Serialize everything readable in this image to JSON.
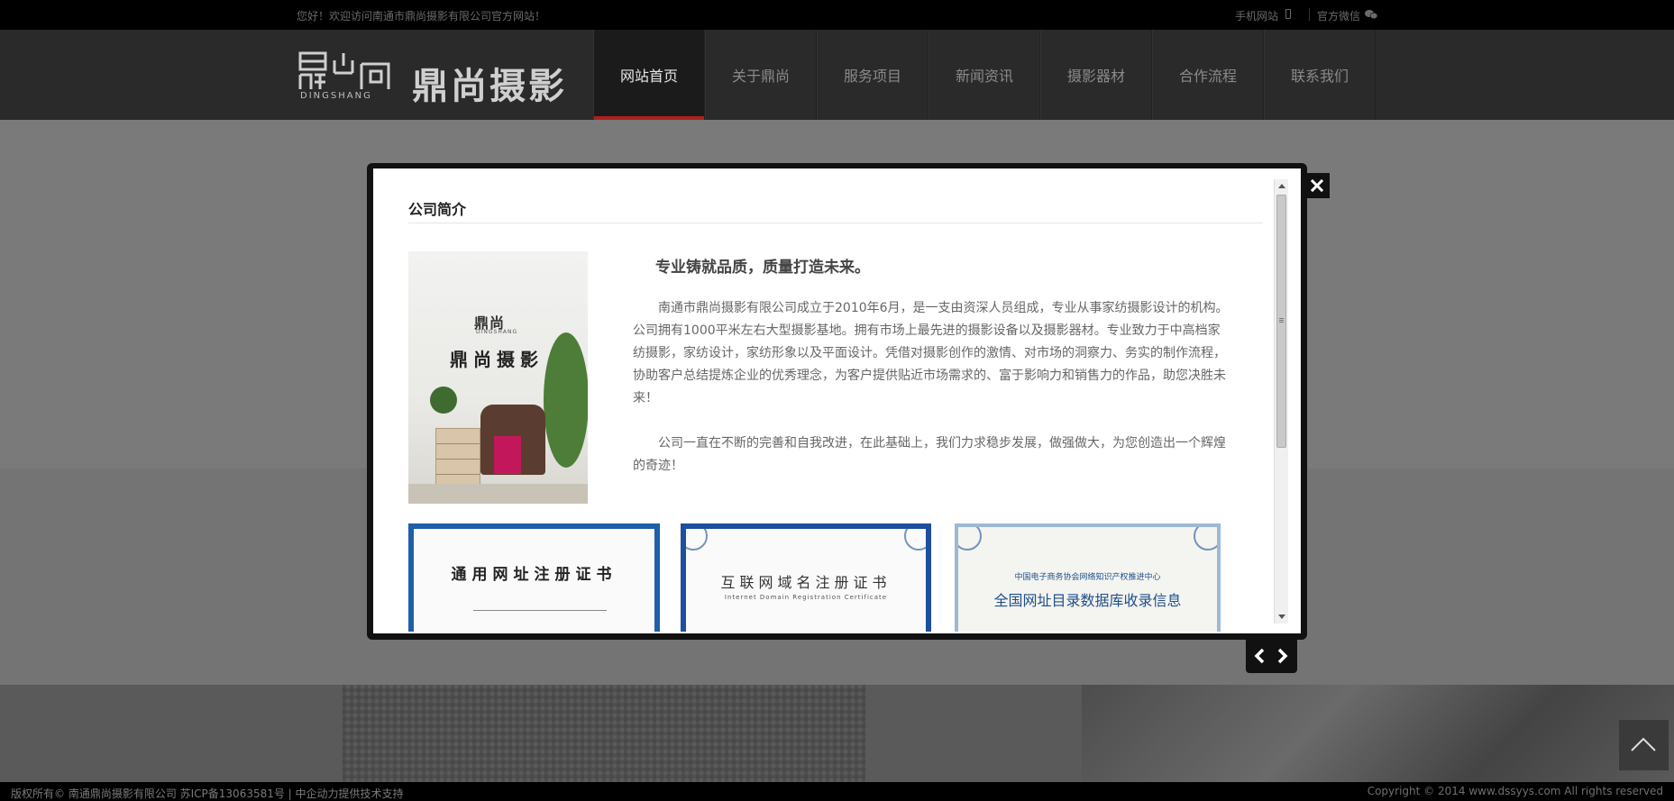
{
  "topbar": {
    "welcome": "您好！欢迎访问南通市鼎尚摄影有限公司官方网站！",
    "mobile_label": "手机网站",
    "wechat_label": "官方微信"
  },
  "logo": {
    "mark": "鼎尚",
    "en": "DINGSHANG",
    "cn": "鼎尚摄影"
  },
  "nav": {
    "items": [
      {
        "label": "网站首页"
      },
      {
        "label": "关于鼎尚"
      },
      {
        "label": "服务项目"
      },
      {
        "label": "新闻资讯"
      },
      {
        "label": "摄影器材"
      },
      {
        "label": "合作流程"
      },
      {
        "label": "联系我们"
      }
    ],
    "active_index": 0
  },
  "modal": {
    "title": "公司简介",
    "slogan": "专业铸就品质，质量打造未来。",
    "paragraph1": "南通市鼎尚摄影有限公司成立于2010年6月，是一支由资深人员组成，专业从事家纺摄影设计的机构。公司拥有1000平米左右大型摄影基地。拥有市场上最先进的摄影设备以及摄影器材。专业致力于中高档家纺摄影，家纺设计，家纺形象以及平面设计。凭借对摄影创作的激情、对市场的洞察力、务实的制作流程，协助客户总结提炼企业的优秀理念，为客户提供贴近市场需求的、富于影响力和销售力的作品，助您决胜未来！",
    "paragraph2": "公司一直在不断的完善和自我改进，在此基础上，我们力求稳步发展，做强做大，为您创造出一个辉煌的奇迹！",
    "poster": {
      "mark": "鼎尚",
      "en": "DINGSHANG",
      "cn": "鼎尚摄影"
    },
    "certificates": [
      {
        "title": "通用网址注册证书"
      },
      {
        "title": "互联网域名注册证书",
        "subtitle": "Internet Domain Registration Certificate"
      },
      {
        "org": "中国电子商务协会网络知识产权推进中心",
        "title": "全国网址目录数据库收录信息"
      }
    ]
  },
  "footer": {
    "copyright": "版权所有© 南通鼎尚摄影有限公司 苏ICP备13063581号 | 中企动力提供技术支持",
    "right": "Copyright © 2014 www.dssyys.com All rights reserved"
  },
  "icons": {
    "close": "close-icon",
    "prev": "chevron-left-icon",
    "next": "chevron-right-icon",
    "back_to_top": "chevron-up-icon",
    "phone": "phone-icon",
    "wechat": "wechat-icon"
  },
  "colors": {
    "nav_active_underline": "#b21e1e",
    "header_bg": "#2a2a2a",
    "topbar_bg": "#000000"
  }
}
